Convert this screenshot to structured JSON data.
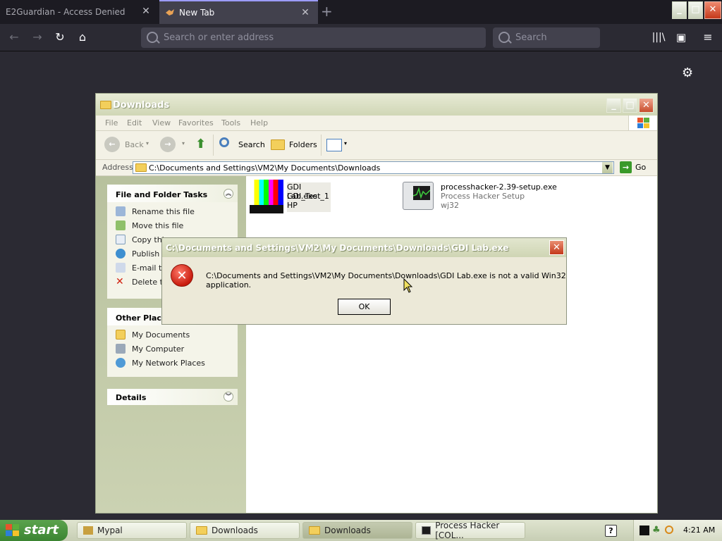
{
  "browser": {
    "tabs": [
      {
        "label": "E2Guardian - Access Denied",
        "active": false
      },
      {
        "label": "New Tab",
        "active": true
      }
    ],
    "url_placeholder": "Search or enter address",
    "search_placeholder": "Search"
  },
  "explorer": {
    "title": "Downloads",
    "menu": [
      "File",
      "Edit",
      "View",
      "Favorites",
      "Tools",
      "Help"
    ],
    "toolbar": {
      "back": "Back",
      "search": "Search",
      "folders": "Folders"
    },
    "address_label": "Address",
    "address_value": "C:\\Documents and Settings\\VM2\\My Documents\\Downloads",
    "go": "Go",
    "tasks_panel": {
      "title": "File and Folder Tasks",
      "items": [
        "Rename this file",
        "Move this file",
        "Copy thi",
        "Publish t",
        "E-mail th",
        "Delete th"
      ]
    },
    "places_panel": {
      "title": "Other Place",
      "items": [
        "My Documents",
        "My Computer",
        "My Network Places"
      ]
    },
    "details_panel": {
      "title": "Details"
    },
    "files": [
      {
        "name": "GDI Lab.exe",
        "line2": "GDI_Test_1",
        "line3": "HP"
      },
      {
        "name": "processhacker-2.39-setup.exe",
        "line2": "Process Hacker Setup",
        "line3": "wj32"
      }
    ]
  },
  "dialog": {
    "title": "C:\\Documents and Settings\\VM2\\My Documents\\Downloads\\GDI Lab.exe",
    "message": "C:\\Documents and Settings\\VM2\\My Documents\\Downloads\\GDI Lab.exe is not a valid Win32 application.",
    "ok": "OK"
  },
  "taskbar": {
    "start": "start",
    "tasks": [
      {
        "label": "Mypal",
        "active": false
      },
      {
        "label": "Downloads",
        "active": false
      },
      {
        "label": "Downloads",
        "active": true
      },
      {
        "label": "Process Hacker [COL...",
        "active": false
      }
    ],
    "clock": "4:21 AM"
  },
  "colors": {
    "xp_green": "#3b8532",
    "error_red": "#c81c0e",
    "firefox_bg": "#2b2a33"
  }
}
